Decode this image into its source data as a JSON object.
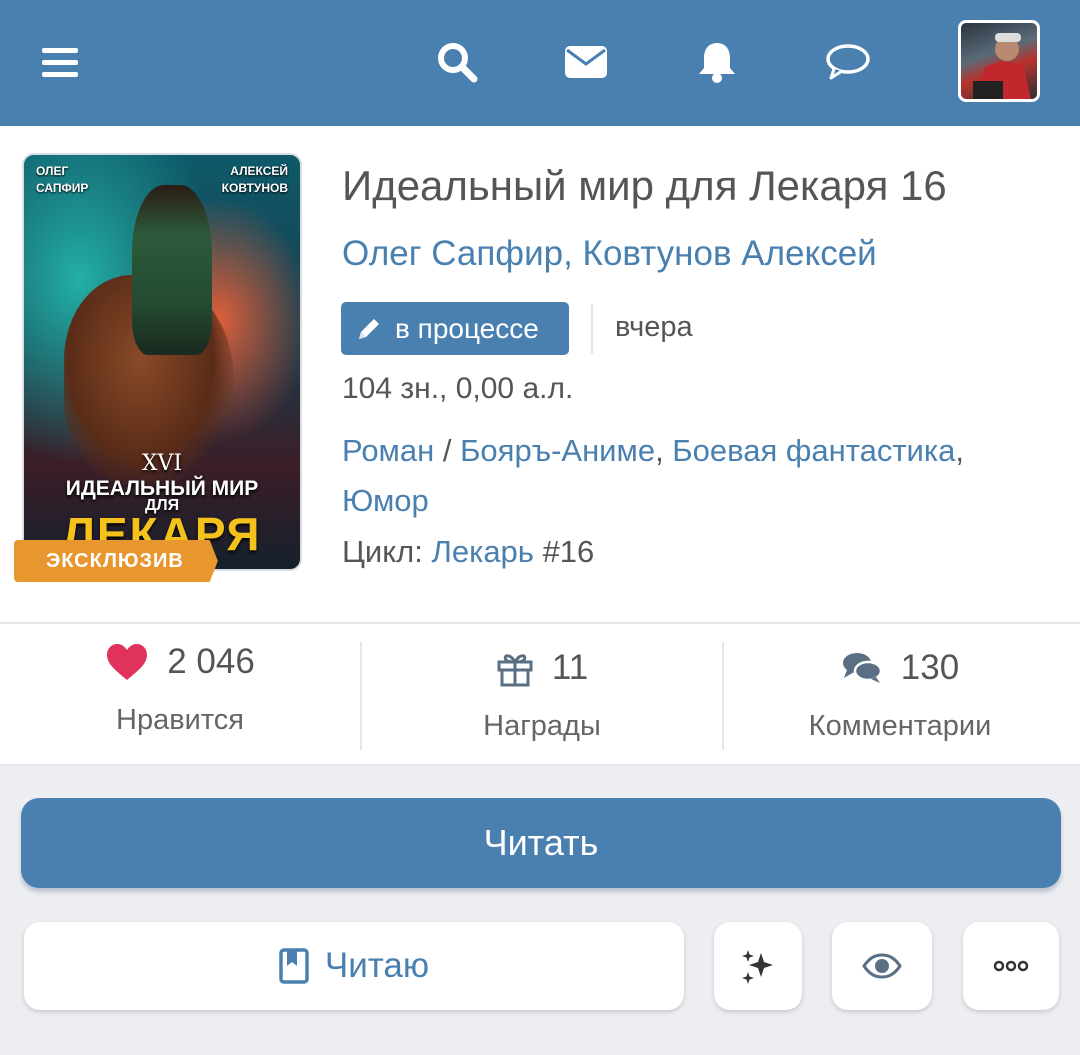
{
  "header": {
    "icons": [
      "menu-icon",
      "search-icon",
      "mail-icon",
      "bell-icon",
      "chat-icon"
    ],
    "colors": {
      "bar": "#4a80b0",
      "icon": "#ffffff"
    }
  },
  "book": {
    "title": "Идеальный мир для Лекаря 16",
    "authors": "Олег Сапфир, Ковтунов Алексей",
    "status_label": "в процессе",
    "updated": "вчера",
    "size": "104 зн., 0,00 а.л.",
    "genres": {
      "primary": "Роман",
      "separator": " / ",
      "items": [
        "Бояръ-Аниме",
        "Боевая фантастика",
        "Юмор"
      ]
    },
    "cycle_prefix": "Цикл: ",
    "cycle_name": "Лекарь",
    "cycle_number": " #16",
    "cover": {
      "author_left_1": "ОЛЕГ",
      "author_left_2": "САПФИР",
      "author_right_1": "АЛЕКСЕЙ",
      "author_right_2": "КОВТУНОВ",
      "volume": "XVI",
      "title_line1": "ИДЕАЛЬНЫЙ МИР",
      "title_line2": "ДЛЯ",
      "title_line3": "ЛЕКАРЯ"
    },
    "badge": "ЭКСКЛЮЗИВ"
  },
  "stats": {
    "likes": {
      "value": "2 046",
      "label": "Нравится",
      "icon": "heart-icon"
    },
    "awards": {
      "value": "11",
      "label": "Награды",
      "icon": "gift-icon"
    },
    "comments": {
      "value": "130",
      "label": "Комментарии",
      "icon": "comments-icon"
    }
  },
  "actions": {
    "read": "Читать",
    "reading": "Читаю",
    "icons": [
      "bookmark-icon",
      "sparkles-icon",
      "eye-icon",
      "more-icon"
    ]
  },
  "colors": {
    "accent": "#4a80b0",
    "badge": "#e8962e",
    "heart": "#e0325a",
    "text": "#555555",
    "background": "#eceef2"
  }
}
